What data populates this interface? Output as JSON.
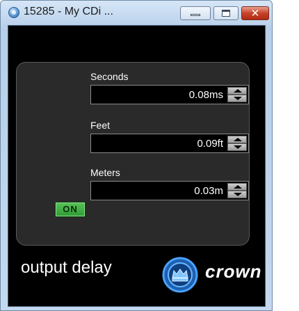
{
  "window": {
    "title": "15285 - My CDi ...",
    "icon": "app-globe-icon",
    "controls": {
      "minimize": "minimize-icon",
      "maximize": "maximize-icon",
      "close": "close-icon",
      "close_glyph": "✕"
    }
  },
  "delay": {
    "seconds": {
      "label": "Seconds",
      "value": "0.08ms"
    },
    "feet": {
      "label": "Feet",
      "value": "0.09ft"
    },
    "meters": {
      "label": "Meters",
      "value": "0.03m"
    }
  },
  "toggle": {
    "label": "ON",
    "state": "on",
    "color": "#3aa83e"
  },
  "footer": {
    "label": "output delay",
    "brand": "crown",
    "logo_icon": "crown-logo-icon",
    "logo_color": "#2f7fd0"
  }
}
